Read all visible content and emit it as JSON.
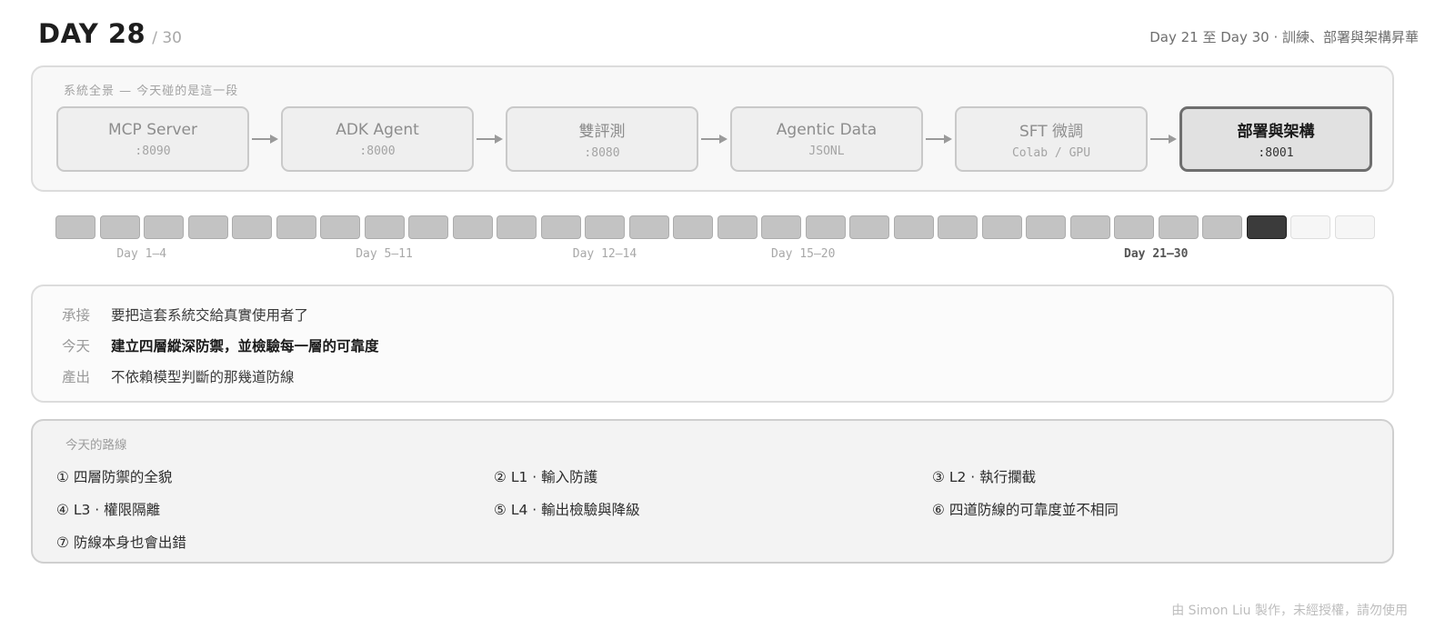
{
  "header": {
    "day": "DAY 28",
    "total": "/ 30",
    "phase": "Day 21 至 Day 30 · 訓練、部署與架構昇華"
  },
  "overview": {
    "label": "系統全景 — 今天碰的是這一段",
    "nodes": [
      {
        "name": "MCP Server",
        "port": ":8090",
        "active": false
      },
      {
        "name": "ADK Agent",
        "port": ":8000",
        "active": false
      },
      {
        "name": "雙評測",
        "port": ":8080",
        "active": false
      },
      {
        "name": "Agentic Data",
        "port": "JSONL",
        "active": false
      },
      {
        "name": "SFT 微調",
        "port": "Colab / GPU",
        "active": false
      },
      {
        "name": "部署與架構",
        "port": ":8001",
        "active": true
      }
    ]
  },
  "progress": {
    "total_days": 30,
    "current_day": 28,
    "ranges": [
      {
        "label": "Day 1–4",
        "start": 1,
        "end": 4,
        "current": false
      },
      {
        "label": "Day 5–11",
        "start": 5,
        "end": 11,
        "current": false
      },
      {
        "label": "Day 12–14",
        "start": 12,
        "end": 14,
        "current": false
      },
      {
        "label": "Day 15–20",
        "start": 15,
        "end": 20,
        "current": false
      },
      {
        "label": "Day 21–30",
        "start": 21,
        "end": 30,
        "current": true
      }
    ]
  },
  "context": {
    "rows": [
      {
        "key": "承接",
        "value": "要把這套系統交給真實使用者了"
      },
      {
        "key": "今天",
        "value": "建立四層縱深防禦，並檢驗每一層的可靠度"
      },
      {
        "key": "產出",
        "value": "不依賴模型判斷的那幾道防線"
      }
    ]
  },
  "route": {
    "label": "今天的路線",
    "items": [
      "① 四層防禦的全貌",
      "② L1 · 輸入防護",
      "③ L2 · 執行攔截",
      "④ L3 · 權限隔離",
      "⑤ L4 · 輸出檢驗與降級",
      "⑥ 四道防線的可靠度並不相同",
      "⑦ 防線本身也會出錯"
    ]
  },
  "footer": "由 Simon Liu 製作，未經授權，請勿使用"
}
